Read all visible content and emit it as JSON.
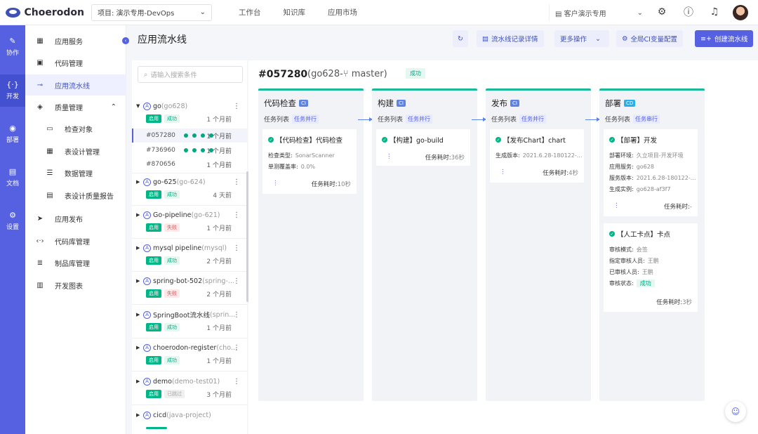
{
  "app": {
    "name": "Choerodon"
  },
  "header": {
    "project": "项目: 演示专用-DevOps",
    "nav": [
      "工作台",
      "知识库",
      "应用市场"
    ],
    "org": "客户演示专用"
  },
  "rail": [
    {
      "label": "协作",
      "icon": "✎"
    },
    {
      "label": "开发",
      "icon": "{·}"
    },
    {
      "label": "部署",
      "icon": "◉"
    },
    {
      "label": "文档",
      "icon": "▤"
    },
    {
      "label": "设置",
      "icon": "⚙"
    }
  ],
  "sidebar": {
    "items": [
      {
        "label": "应用服务",
        "icon": "▦"
      },
      {
        "label": "代码管理",
        "icon": "▣"
      },
      {
        "label": "应用流水线",
        "icon": "⊸"
      },
      {
        "label": "质量管理",
        "icon": "◈",
        "caret": "⌃"
      },
      {
        "label": "检查对象",
        "icon": "▭"
      },
      {
        "label": "表设计管理",
        "icon": "▦"
      },
      {
        "label": "数据管理",
        "icon": "☰"
      },
      {
        "label": "表设计质量报告",
        "icon": "▤"
      },
      {
        "label": "应用发布",
        "icon": "➤"
      },
      {
        "label": "代码库管理",
        "icon": "‹·›"
      },
      {
        "label": "制品库管理",
        "icon": "≣"
      },
      {
        "label": "开发图表",
        "icon": "▥"
      }
    ]
  },
  "page": {
    "title": "应用流水线",
    "refresh_icon": "↻",
    "records_btn": "流水线记录详情",
    "more_btn": "更多操作",
    "ci_vars_btn": "全局CI变量配置",
    "create_btn": "创建流水线"
  },
  "list": {
    "search_placeholder": "请输入搜索条件",
    "on_tag": "启用",
    "pipelines": [
      {
        "name": "go",
        "alias": "(go628)",
        "status": "成功",
        "status_kind": "ok",
        "time": "1 个月前",
        "expanded": true
      },
      {
        "name": "go-625",
        "alias": "(go-624)",
        "status": "成功",
        "status_kind": "ok",
        "time": "4 天前"
      },
      {
        "name": "Go-pipeline",
        "alias": "(go-621)",
        "status": "失败",
        "status_kind": "fail",
        "time": "1 个月前"
      },
      {
        "name": "mysql pipeline",
        "alias": "(mysql)",
        "status": "成功",
        "status_kind": "ok",
        "time": "2 个月前"
      },
      {
        "name": "spring-bot-502",
        "alias": "(spring-...",
        "status": "失败",
        "status_kind": "fail",
        "time": "2 个月前"
      },
      {
        "name": "SpringBoot流水线",
        "alias": "(sprin...",
        "status": "成功",
        "status_kind": "ok",
        "time": "1 个月前"
      },
      {
        "name": "choerodon-register",
        "alias": "(cho...",
        "status": "成功",
        "status_kind": "ok",
        "time": "1 个月前"
      },
      {
        "name": "demo",
        "alias": "(demo-test01)",
        "status": "已跳过",
        "status_kind": "skip",
        "time": "3 个月前"
      },
      {
        "name": "cicd",
        "alias": "(java-project)",
        "status": "",
        "status_kind": "ok",
        "time": ""
      }
    ],
    "records": [
      {
        "id": "#057280",
        "time": "1 个月前",
        "active": true,
        "dots": 4
      },
      {
        "id": "#736960",
        "time": "1 个月前",
        "dots": 4
      },
      {
        "id": "#870656",
        "time": "1 个月前",
        "dots": 0
      }
    ]
  },
  "run": {
    "id": "#057280",
    "app": "(go628-",
    "branch_icon": "⑂",
    "branch": "master)",
    "status": "成功"
  },
  "stages": [
    {
      "title": "代码检查",
      "badge": "CI",
      "list_label": "任务列表",
      "mode": "任务并行",
      "cards": [
        {
          "title": "【代码检查】代码检查",
          "kv": [
            [
              "检查类型:",
              "SonarScanner"
            ],
            [
              "单测覆盖率:",
              "0.0%"
            ]
          ],
          "duration_label": "任务耗时:",
          "duration": "10秒"
        }
      ]
    },
    {
      "title": "构建",
      "badge": "CI",
      "list_label": "任务列表",
      "mode": "任务并行",
      "cards": [
        {
          "title": "【构建】go-build",
          "kv": [],
          "duration_label": "任务耗时:",
          "duration": "36秒"
        }
      ]
    },
    {
      "title": "发布",
      "badge": "CI",
      "list_label": "任务列表",
      "mode": "任务并行",
      "cards": [
        {
          "title": "【发布Chart】chart",
          "kv": [
            [
              "生成版本:",
              "2021.6.28-180122-..."
            ]
          ],
          "duration_label": "任务耗时:",
          "duration": "4秒"
        }
      ]
    },
    {
      "title": "部署",
      "badge": "CD",
      "list_label": "任务列表",
      "mode": "任务串行",
      "cards": [
        {
          "title": "【部署】开发",
          "kv": [
            [
              "部署环境:",
              "久立项目-开发环境"
            ],
            [
              "应用服务:",
              "go628"
            ],
            [
              "服务版本:",
              "2021.6.28-180122-..."
            ],
            [
              "生成实例:",
              "go628-af3f7"
            ]
          ],
          "duration_label": "任务耗时:",
          "duration": "-"
        },
        {
          "title": "【人工卡点】卡点",
          "kv": [
            [
              "审核模式:",
              "会签"
            ],
            [
              "指定审核人员:",
              "王鹏"
            ],
            [
              "已审核人员:",
              "王鹏"
            ],
            [
              "审核状态:",
              "成功"
            ]
          ],
          "duration_label": "任务耗时:",
          "duration": "3秒"
        }
      ]
    }
  ]
}
